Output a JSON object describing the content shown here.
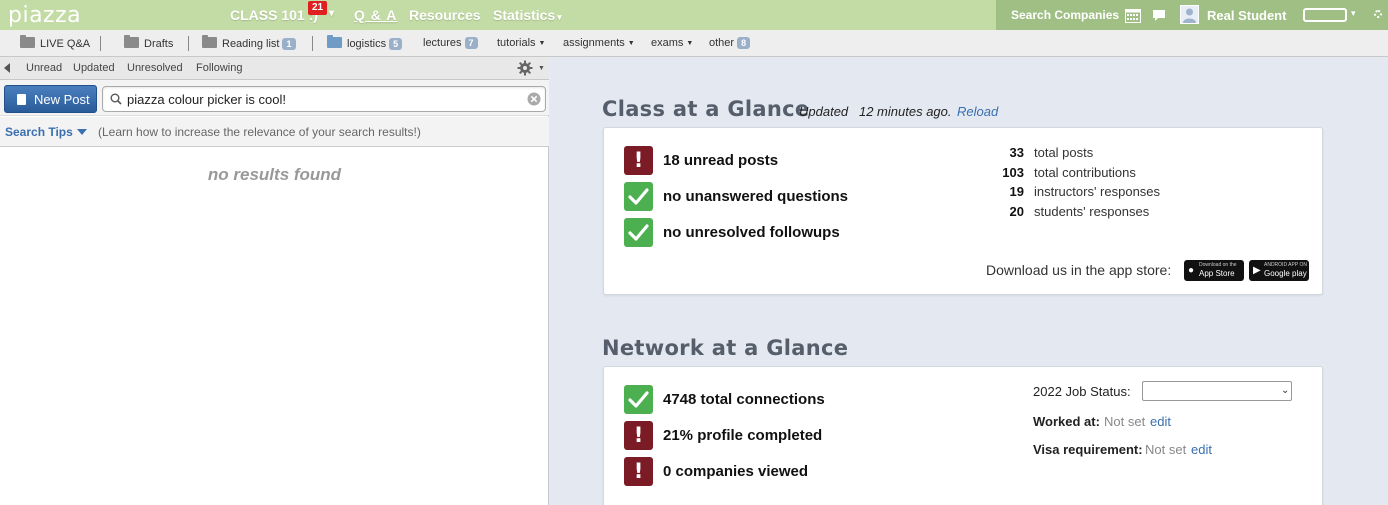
{
  "topbar": {
    "logo": "piazza",
    "class_name": "CLASS 101 :)",
    "class_badge": "21",
    "nav": {
      "qa": "Q & A",
      "resources": "Resources",
      "statistics": "Statistics"
    },
    "search_companies": "Search Companies",
    "user_name": "Real Student",
    "colors": {
      "bar": "#c3dba5",
      "right": "#9fbf85"
    }
  },
  "folders": {
    "live_qa": "LIVE Q&A",
    "drafts": "Drafts",
    "reading_list": "Reading list",
    "reading_list_count": "1",
    "logistics": "logistics",
    "logistics_count": "5",
    "lectures": "lectures",
    "lectures_count": "7",
    "tutorials": "tutorials",
    "assignments": "assignments",
    "exams": "exams",
    "other": "other",
    "other_count": "8"
  },
  "filters": {
    "unread": "Unread",
    "updated": "Updated",
    "unresolved": "Unresolved",
    "following": "Following"
  },
  "search": {
    "new_post": "New Post",
    "value": "piazza colour picker is cool!",
    "tips_link": "Search Tips",
    "tips_text": "(Learn how to increase the relevance of your search results!)",
    "no_results": "no results found"
  },
  "class_glance": {
    "title": "Class at a Glance",
    "updated": "Updated   12 minutes ago.",
    "reload": "Reload",
    "items": [
      {
        "label": "18 unread posts",
        "status": "warn"
      },
      {
        "label": "no unanswered questions",
        "status": "ok"
      },
      {
        "label": "no unresolved followups",
        "status": "ok"
      }
    ],
    "stats": [
      {
        "num": "33",
        "label": "total posts"
      },
      {
        "num": "103",
        "label": "total contributions"
      },
      {
        "num": "19",
        "label": "instructors' responses"
      },
      {
        "num": "20",
        "label": "students' responses"
      }
    ],
    "app_store_text": "Download us in the app store:",
    "appstore_small": "Download on the",
    "appstore_big": "App Store",
    "googleplay_small": "ANDROID APP ON",
    "googleplay_big": "Google play"
  },
  "network_glance": {
    "title": "Network at a Glance",
    "items": [
      {
        "label": "4748 total connections",
        "status": "ok"
      },
      {
        "label": "21% profile completed",
        "status": "warn"
      },
      {
        "label": "0 companies viewed",
        "status": "warn"
      }
    ],
    "job_status_label": "2022 Job Status:",
    "job_status_value": "",
    "worked_at_label": "Worked at:",
    "worked_at_value": "Not set",
    "worked_at_edit": "edit",
    "visa_label": "Visa requirement:",
    "visa_value": "Not set",
    "visa_edit": "edit"
  }
}
